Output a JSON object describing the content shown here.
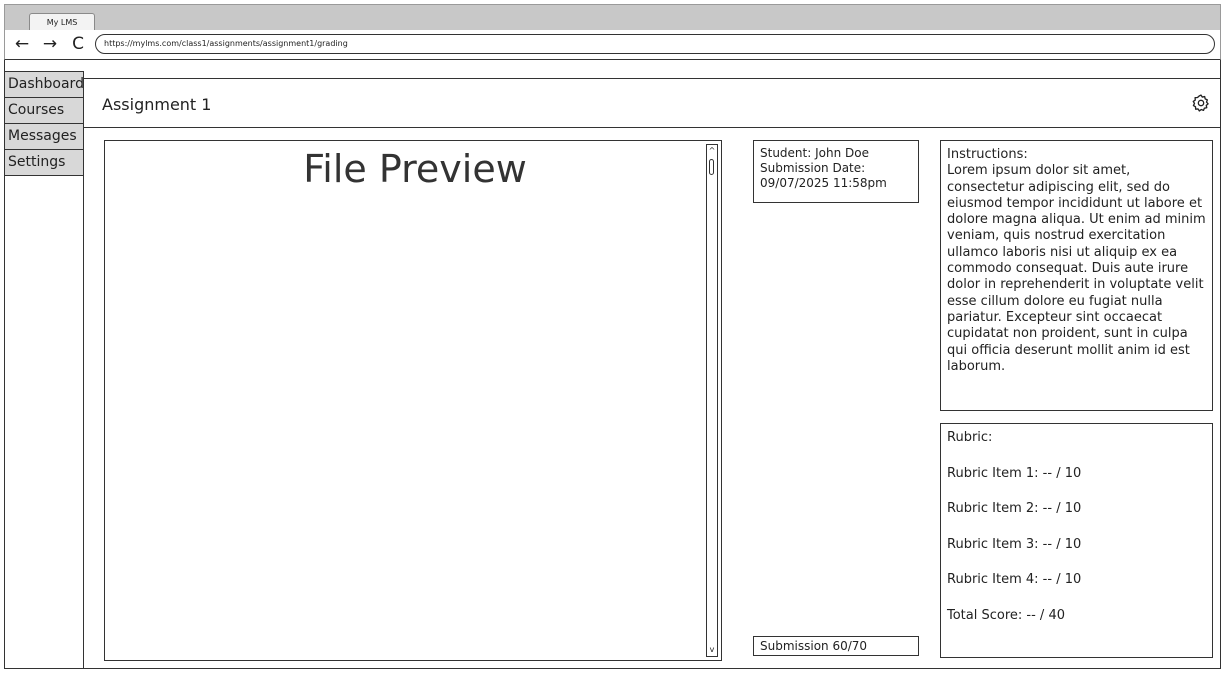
{
  "browser": {
    "tab_title": "My LMS",
    "back_icon": "arrow-left-icon",
    "forward_icon": "arrow-right-icon",
    "reload_icon": "reload-icon",
    "back_glyph": "←",
    "forward_glyph": "→",
    "reload_glyph": "C",
    "url": "https://mylms.com/class1/assignments/assignment1/grading"
  },
  "sidebar": {
    "items": [
      {
        "label": "Dashboard"
      },
      {
        "label": "Courses"
      },
      {
        "label": "Messages"
      },
      {
        "label": "Settings"
      }
    ]
  },
  "header": {
    "title": "Assignment 1",
    "settings_icon": "gear-icon"
  },
  "preview": {
    "title": "File Preview",
    "scroll_up_glyph": "^",
    "scroll_down_glyph": "v"
  },
  "student": {
    "name_line": "Student: John Doe",
    "date_label": "Submission Date:",
    "date_value": "09/07/2025 11:58pm"
  },
  "submission": {
    "label": "Submission 60/70"
  },
  "instructions": {
    "label": "Instructions:",
    "body": "Lorem ipsum dolor sit amet, consectetur adipiscing elit, sed do eiusmod tempor incididunt ut labore et dolore magna aliqua. Ut enim ad minim veniam, quis nostrud exercitation ullamco laboris nisi ut aliquip ex ea commodo consequat. Duis aute irure dolor in reprehenderit in voluptate velit esse cillum dolore eu fugiat nulla pariatur. Excepteur sint occaecat cupidatat non proident, sunt in culpa qui officia deserunt mollit anim id est laborum."
  },
  "rubric": {
    "label": "Rubric:",
    "items": [
      "Rubric Item 1: -- / 10",
      "Rubric Item 2: -- / 10",
      "Rubric Item 3: -- / 10",
      "Rubric Item 4: -- / 10"
    ],
    "total": "Total Score: -- / 40"
  }
}
